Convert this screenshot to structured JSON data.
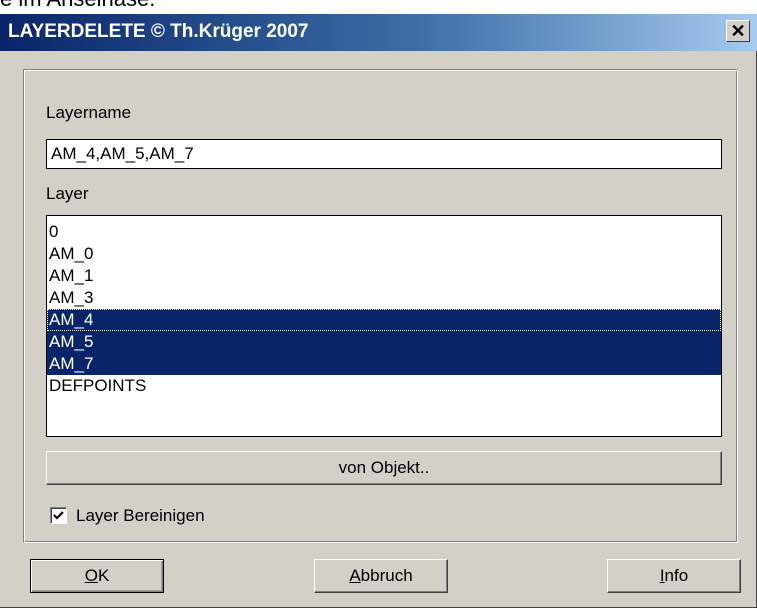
{
  "background_text": "e im Anseinase.",
  "window": {
    "title": "LAYERDELETE © Th.Krüger 2007",
    "close_glyph": "✕"
  },
  "layername": {
    "label": "Layername",
    "value": "AM_4,AM_5,AM_7"
  },
  "layer": {
    "label": "Layer",
    "items": [
      {
        "label": "0",
        "selected": false
      },
      {
        "label": "AM_0",
        "selected": false
      },
      {
        "label": "AM_1",
        "selected": false
      },
      {
        "label": "AM_3",
        "selected": false
      },
      {
        "label": "AM_4",
        "selected": true,
        "focused": true
      },
      {
        "label": "AM_5",
        "selected": true
      },
      {
        "label": "AM_7",
        "selected": true
      },
      {
        "label": "DEFPOINTS",
        "selected": false
      }
    ]
  },
  "from_object_button": "von Objekt..",
  "purge_checkbox": {
    "label": "Layer Bereinigen",
    "checked": true
  },
  "buttons": {
    "ok": {
      "accel": "O",
      "rest": "K"
    },
    "cancel": {
      "accel": "A",
      "rest": "bbruch"
    },
    "info": {
      "accel": "I",
      "rest": "nfo"
    }
  },
  "colors": {
    "selection": "#0a246a",
    "dialog_face": "#d4d0c8"
  }
}
